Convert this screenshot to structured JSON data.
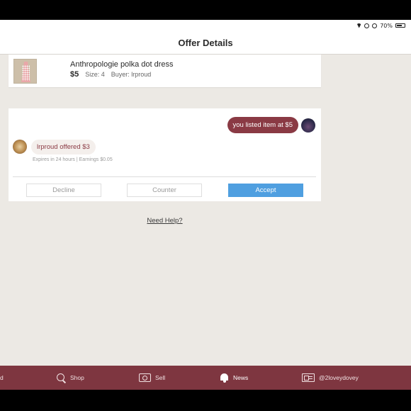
{
  "status_bar": {
    "battery": "70%",
    "battery_level": 0.7
  },
  "nav": {
    "title": "Offer Details"
  },
  "listing": {
    "title": "Anthropologie polka dot dress",
    "price": "$5",
    "size": "Size: 4",
    "buyer": "Buyer: lrproud",
    "thumb_icon": "dress-thumbnail"
  },
  "offer": {
    "listed_message": "you listed item at $5",
    "offered_message": "lrproud offered $3",
    "note": "Expires in 24 hours | Earnings $0.05",
    "decline_label": "Decline",
    "counter_label": "Counter",
    "accept_label": "Accept",
    "bubble_color": "#8a3a44",
    "accept_color": "#4f9fe0"
  },
  "help": {
    "label": "Need Help?"
  },
  "tab_bar": {
    "color": "#7e3640",
    "tabs": [
      {
        "label": "d",
        "icon": ""
      },
      {
        "label": "Shop",
        "icon": "search-icon"
      },
      {
        "label": "Sell",
        "icon": "camera-icon"
      },
      {
        "label": "News",
        "icon": "bell-icon"
      },
      {
        "label": "@2loveydovey",
        "icon": "profile-card-icon"
      }
    ]
  }
}
